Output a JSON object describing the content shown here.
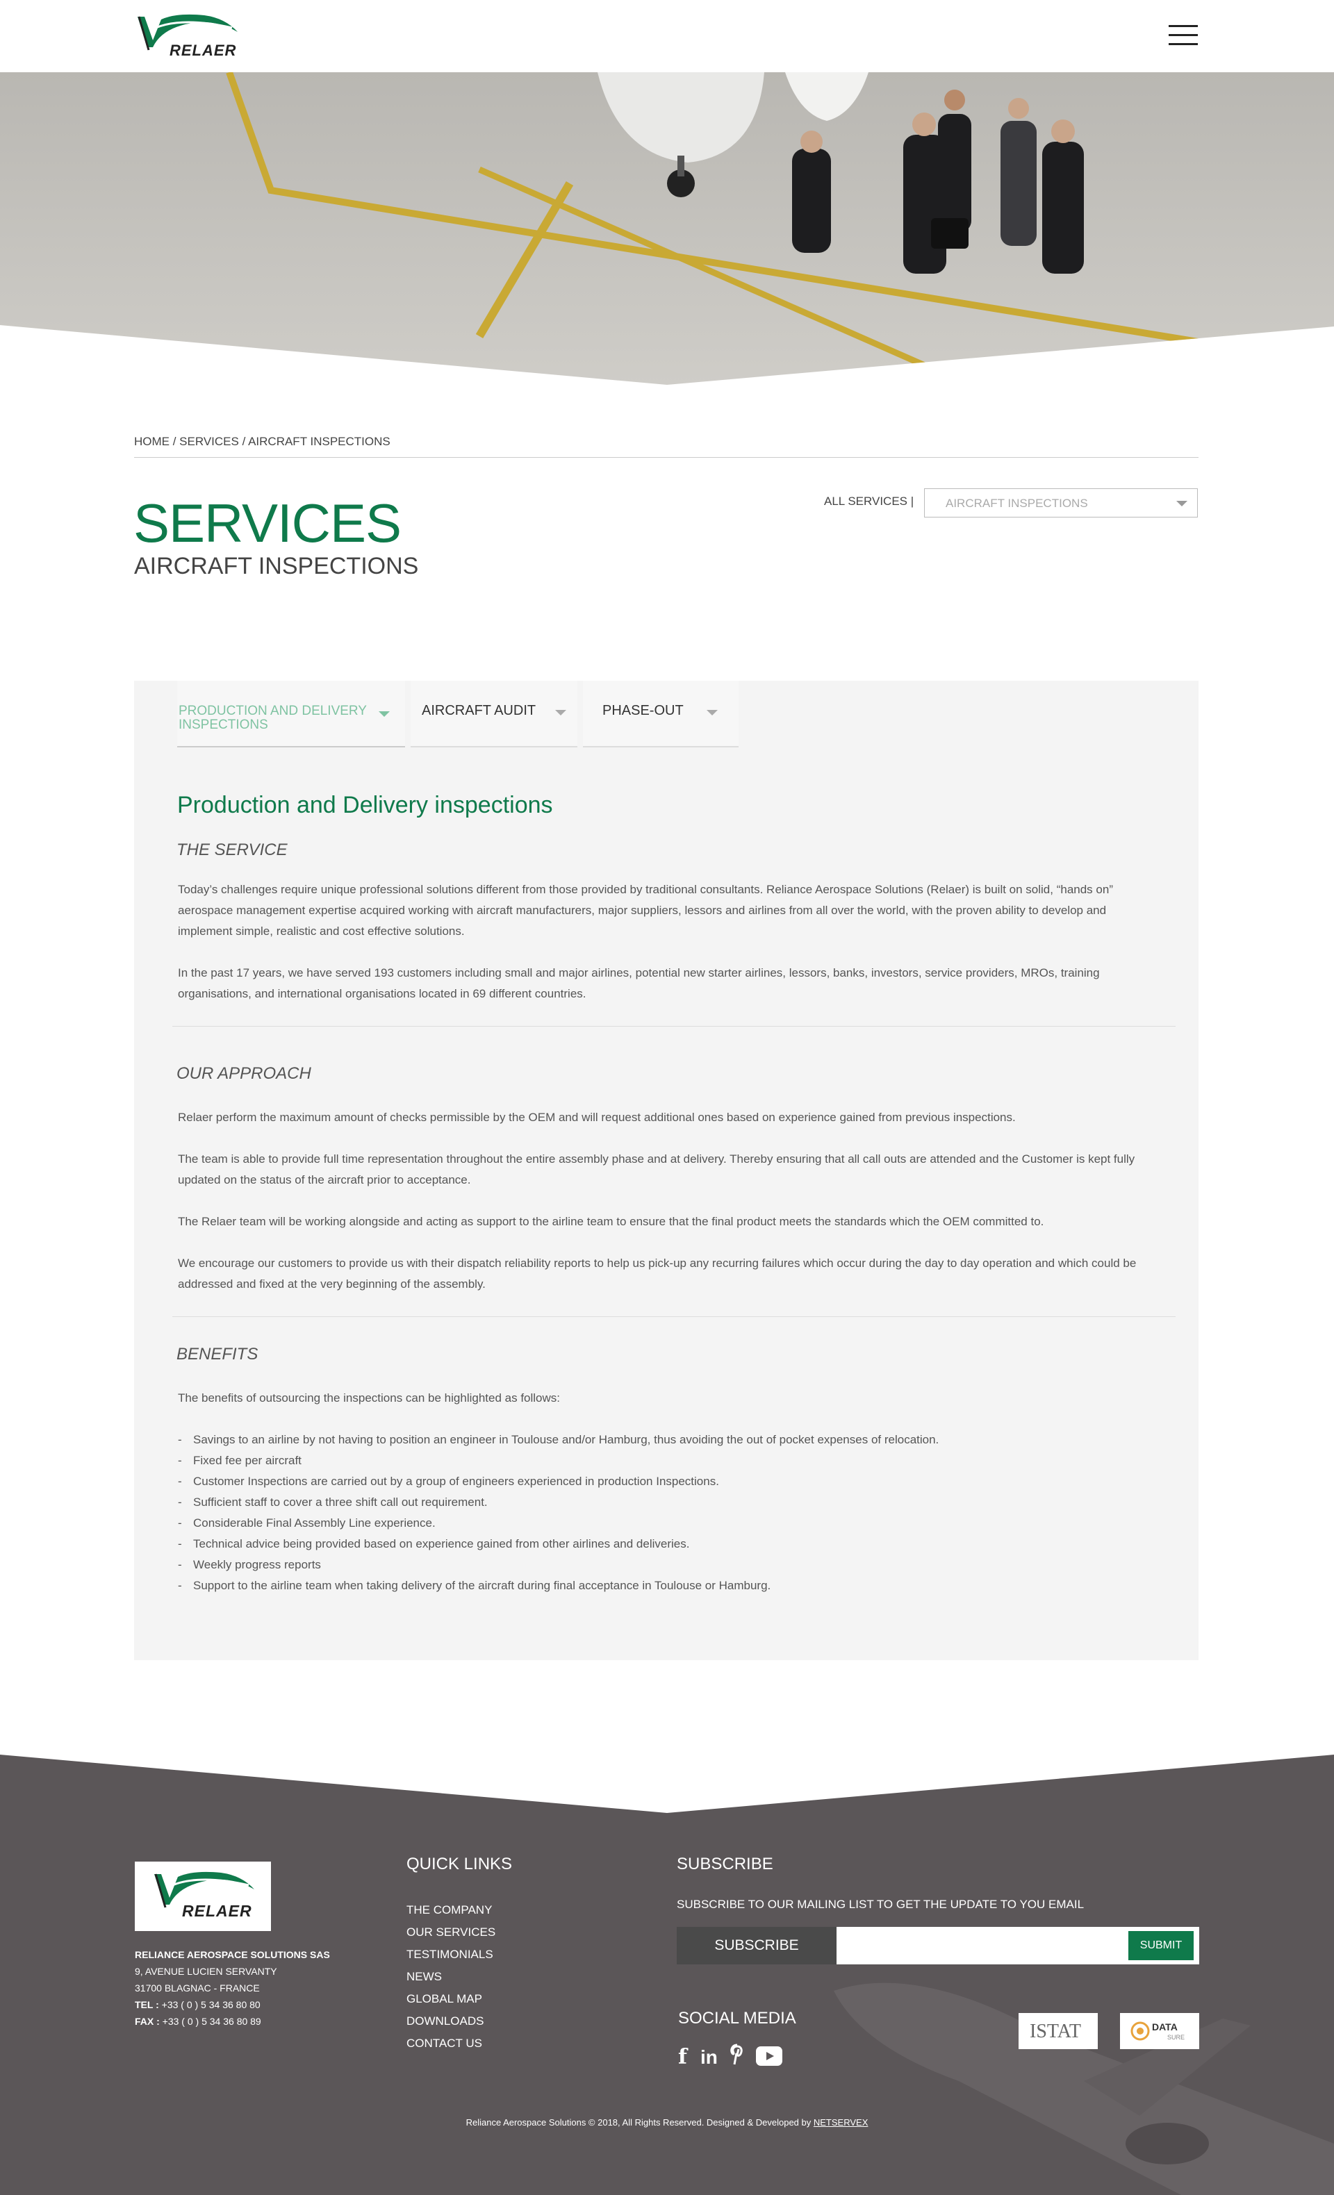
{
  "header": {
    "brand": "RELAER",
    "menu_label": "Menu"
  },
  "breadcrumb": {
    "home": "HOME",
    "services": "SERVICES",
    "current": "AIRCRAFT INSPECTIONS",
    "separator": " / "
  },
  "page": {
    "title": "SERVICES",
    "subtitle": "AIRCRAFT INSPECTIONS"
  },
  "service_filter": {
    "label": "ALL SERVICES |",
    "selected": "AIRCRAFT INSPECTIONS"
  },
  "tabs": [
    {
      "label_line1": "PRODUCTION AND DELIVERY",
      "label_line2": "INSPECTIONS",
      "active": true
    },
    {
      "label": "AIRCRAFT AUDIT",
      "active": false
    },
    {
      "label": "PHASE-OUT",
      "active": false
    }
  ],
  "content": {
    "section_title": "Production and Delivery inspections",
    "service": {
      "heading": "THE SERVICE",
      "p1": "Today’s challenges require unique professional solutions different from those provided by traditional consultants.  Reliance Aerospace Solutions (Relaer) is built on solid, “hands on” aerospace management expertise acquired working with aircraft manufacturers, major suppliers, lessors and airlines from all over the world, with the proven ability to develop and implement simple, realistic and cost effective solutions.",
      "p2": "In the past 17 years, we have served 193 customers including small and major airlines, potential new starter airlines, lessors, banks, investors, service providers, MROs, training organisations, and international organisations located in 69 different countries."
    },
    "approach": {
      "heading": "OUR APPROACH",
      "p1": "Relaer perform the maximum amount of checks permissible by the OEM and will request additional ones based on experience gained from previous inspections.",
      "p2": "The team is able to provide full time representation throughout the entire assembly phase and at delivery. Thereby ensuring that all call outs are attended and the Customer is kept fully updated on the status of the aircraft prior to acceptance.",
      "p3": "The Relaer team will be working alongside and acting as support to the airline team to ensure that the final product meets the standards which the OEM committed to.",
      "p4": "We encourage our customers to provide us with their dispatch reliability reports to help us pick-up any recurring failures which occur during the day to day operation and which could be addressed and fixed at the very beginning of the assembly."
    },
    "benefits": {
      "heading": "BENEFITS",
      "intro": "The benefits of outsourcing the inspections can be highlighted as follows:",
      "items": [
        "Savings to an airline by not having to position an engineer in Toulouse and/or Hamburg, thus avoiding the out of pocket expenses of relocation.",
        "Fixed fee per aircraft",
        "Customer Inspections are carried out by a group of engineers experienced in production Inspections.",
        "Sufficient staff to cover a three shift call out requirement.",
        "Considerable Final Assembly Line experience.",
        "Technical advice being provided based on experience gained from other airlines and deliveries.",
        "Weekly progress reports",
        "Support to the airline team when taking delivery of the aircraft during final acceptance in Toulouse or Hamburg."
      ]
    }
  },
  "footer": {
    "brand": "RELAER",
    "company": "RELIANCE AEROSPACE SOLUTIONS SAS",
    "address1": "9, AVENUE LUCIEN SERVANTY",
    "address2": "31700 BLAGNAC - FRANCE",
    "tel_label": "TEL :",
    "tel": "+33 ( 0 ) 5 34 36 80 80",
    "fax_label": "FAX :",
    "fax": "+33 ( 0 ) 5 34 36 80 89",
    "quick_links_title": "QUICK LINKS",
    "quick_links": [
      "THE COMPANY",
      "OUR SERVICES",
      "TESTIMONIALS",
      "NEWS",
      "GLOBAL MAP",
      "DOWNLOADS",
      "CONTACT US"
    ],
    "subscribe_title": "SUBSCRIBE",
    "subscribe_text": "SUBSCRIBE TO OUR MAILING LIST TO GET THE UPDATE TO YOU EMAIL",
    "subscribe_label": "SUBSCRIBE",
    "subscribe_button": "SUBMIT",
    "social_title": "SOCIAL MEDIA",
    "social": [
      "facebook-icon",
      "linkedin-icon",
      "pinterest-icon",
      "youtube-icon"
    ],
    "partners": [
      "ISTAT",
      "DATA"
    ],
    "partner_data_sub": "SURE",
    "copyright": "Reliance Aerospace Solutions © 2018, All Rights Reserved. Designed & Developed by",
    "developer": "NETSERVEX"
  },
  "colors": {
    "brand_green": "#0f7a4b",
    "tab_active": "#7fc3a2",
    "footer_bg": "#5b5658",
    "panel_bg": "#f4f4f4"
  }
}
